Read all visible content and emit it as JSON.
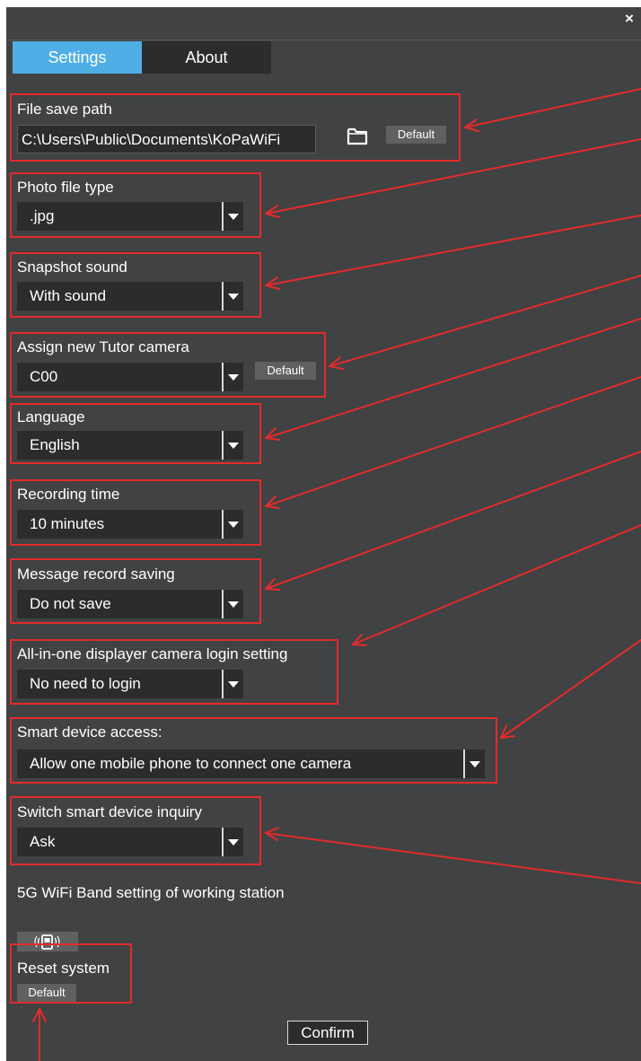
{
  "window": {
    "close_symbol": "×"
  },
  "tabs": [
    {
      "label": "Settings",
      "active": true
    },
    {
      "label": "About",
      "active": false
    }
  ],
  "file_save_path": {
    "label": "File save path",
    "value": "C:\\Users\\Public\\Documents\\KoPaWiFi",
    "icon": "folder-icon",
    "default_label": "Default"
  },
  "photo_file_type": {
    "label": "Photo file type",
    "value": ".jpg"
  },
  "snapshot_sound": {
    "label": "Snapshot sound",
    "value": "With sound"
  },
  "tutor_camera": {
    "label": "Assign new Tutor camera",
    "value": "C00",
    "default_label": "Default"
  },
  "language": {
    "label": "Language",
    "value": "English"
  },
  "recording_time": {
    "label": "Recording time",
    "value": "10 minutes"
  },
  "message_record": {
    "label": "Message record saving",
    "value": "Do not save"
  },
  "displayer_login": {
    "label": "All-in-one displayer camera login setting",
    "value": "No need to login"
  },
  "smart_device_access": {
    "label": "Smart device access:",
    "value": "Allow one mobile phone to connect one camera"
  },
  "smart_device_inquiry": {
    "label": "Switch smart device inquiry",
    "value": "Ask"
  },
  "wifi_band": {
    "label": "5G WiFi Band setting of working station",
    "icon": "wifi-phone-icon"
  },
  "reset_system": {
    "label": "Reset system",
    "default_label": "Default"
  },
  "confirm_label": "Confirm",
  "colors": {
    "panel": "#414243",
    "field": "#2b2c2d",
    "accent": "#4eaee5",
    "annotation": "#e32b2b"
  }
}
